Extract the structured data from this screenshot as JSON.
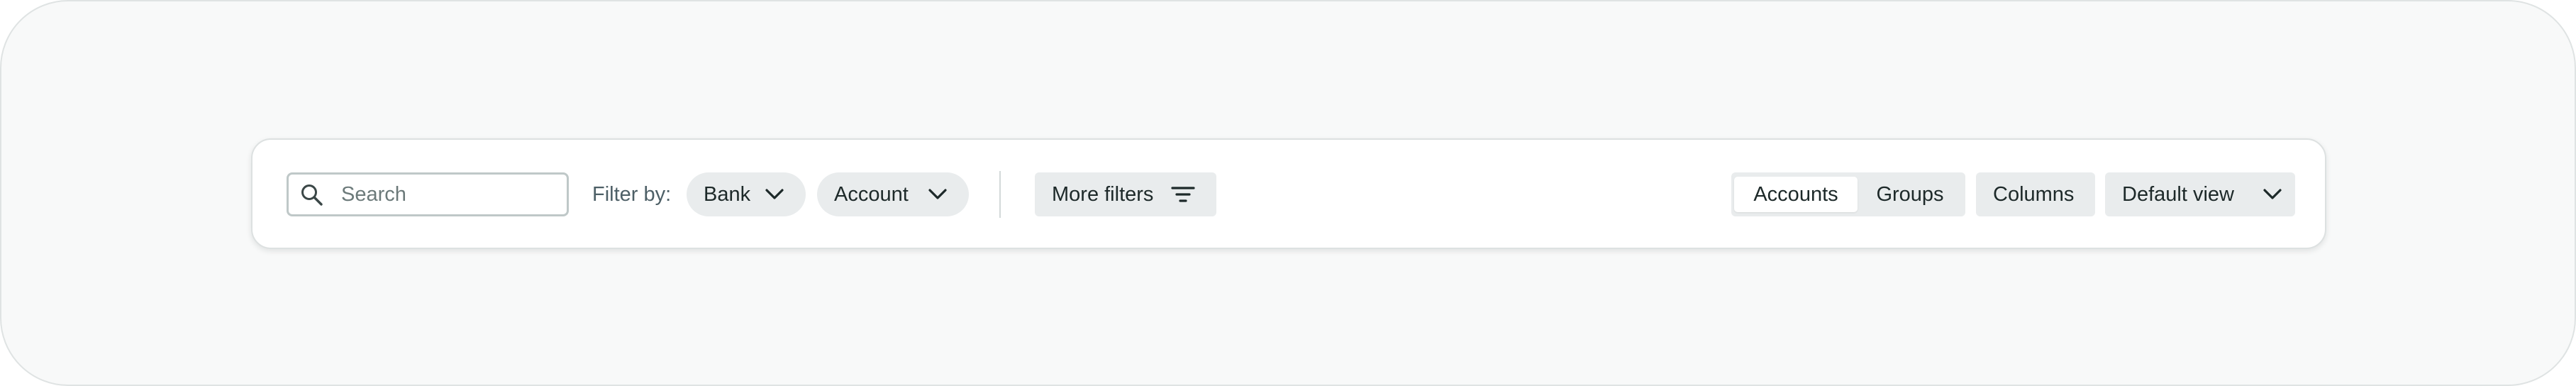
{
  "search": {
    "placeholder": "Search",
    "value": ""
  },
  "filter_label": "Filter by:",
  "filters": [
    {
      "label": "Bank"
    },
    {
      "label": "Account"
    }
  ],
  "more_filters_label": "More filters",
  "view_toggle": {
    "options": [
      "Accounts",
      "Groups"
    ],
    "selected": "Accounts"
  },
  "columns_label": "Columns",
  "view_select": {
    "label": "Default view"
  },
  "icons": {
    "search": "search-icon",
    "chevron": "chevron-down-icon",
    "filter": "filter-lines-icon"
  }
}
